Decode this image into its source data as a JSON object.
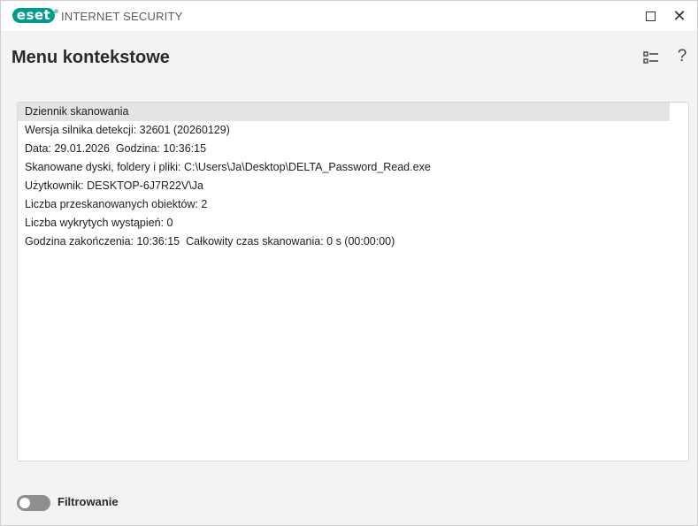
{
  "titlebar": {
    "logo_text": "eset",
    "app_title": "INTERNET SECURITY"
  },
  "header": {
    "title": "Menu kontekstowe",
    "help_glyph": "?"
  },
  "log": {
    "lines": [
      "Dziennik skanowania",
      "Wersja silnika detekcji: 32601 (20260129)",
      "Data: 29.01.2026  Godzina: 10:36:15",
      "Skanowane dyski, foldery i pliki: C:\\Users\\Ja\\Desktop\\DELTA_Password_Read.exe",
      "Użytkownik: DESKTOP-6J7R22V\\Ja",
      "Liczba przeskanowanych obiektów: 2",
      "Liczba wykrytych wystąpień: 0",
      "Godzina zakończenia: 10:36:15  Całkowity czas skanowania: 0 s (00:00:00)"
    ]
  },
  "footer": {
    "filter_label": "Filtrowanie",
    "filter_on": false
  },
  "colors": {
    "brand": "#009a8e",
    "toggle_off": "#8f8f8f"
  }
}
